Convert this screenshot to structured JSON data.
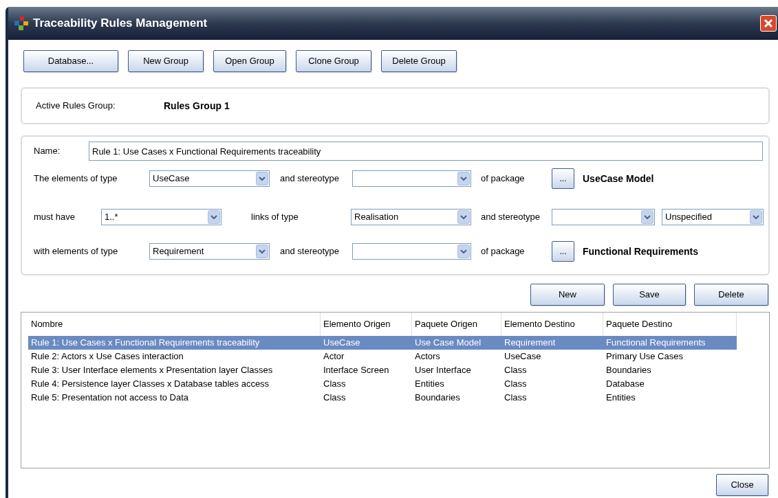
{
  "window": {
    "title": "Traceability Rules Management"
  },
  "toolbar_buttons": [
    "Database...",
    "New Group",
    "Open Group",
    "Clone Group",
    "Delete Group"
  ],
  "active_group": {
    "label": "Active Rules Group:",
    "value": "Rules Group 1"
  },
  "rule_form": {
    "name_label": "Name:",
    "name_value": "Rule 1: Use Cases x Functional Requirements traceability",
    "rows": [
      {
        "items": [
          {
            "kind": "label",
            "text": "The elements of type"
          },
          {
            "kind": "combo",
            "value": "UseCase"
          },
          {
            "kind": "label",
            "text": "and stereotype"
          },
          {
            "kind": "combo",
            "value": ""
          },
          {
            "kind": "label",
            "text": "of package"
          },
          {
            "kind": "browse",
            "text": "..."
          },
          {
            "kind": "package",
            "text": "UseCase Model"
          }
        ]
      },
      {
        "items": [
          {
            "kind": "label",
            "text": "must have"
          },
          {
            "kind": "combo",
            "value": "1..*"
          },
          {
            "kind": "label",
            "text": "links of type"
          },
          {
            "kind": "combo",
            "value": "Realisation"
          },
          {
            "kind": "label",
            "text": "and stereotype"
          },
          {
            "kind": "combo",
            "value": ""
          },
          {
            "kind": "combo",
            "value": "Unspecified"
          }
        ]
      },
      {
        "items": [
          {
            "kind": "label",
            "text": "with elements of type"
          },
          {
            "kind": "combo",
            "value": "Requirement"
          },
          {
            "kind": "label",
            "text": "and stereotype"
          },
          {
            "kind": "combo",
            "value": ""
          },
          {
            "kind": "label",
            "text": "of package"
          },
          {
            "kind": "browse",
            "text": "..."
          },
          {
            "kind": "package",
            "text": "Functional Requirements"
          }
        ]
      }
    ]
  },
  "rule_buttons": [
    "New",
    "Save",
    "Delete"
  ],
  "table": {
    "columns": [
      "Nombre",
      "Elemento Origen",
      "Paquete Origen",
      "Elemento Destino",
      "Paquete Destino"
    ],
    "rows": [
      {
        "selected": true,
        "cells": [
          "Rule 1: Use Cases x Functional Requirements traceability",
          "UseCase",
          "Use Case Model",
          "Requirement",
          "Functional Requirements"
        ]
      },
      {
        "selected": false,
        "cells": [
          "Rule 2: Actors x Use Cases interaction",
          "Actor",
          "Actors",
          "UseCase",
          "Primary Use Cases"
        ]
      },
      {
        "selected": false,
        "cells": [
          "Rule 3: User Interface elements x Presentation layer Classes",
          "Interface Screen",
          "User Interface",
          "Class",
          "Boundaries"
        ]
      },
      {
        "selected": false,
        "cells": [
          "Rule 4: Persistence layer Classes x Database tables access",
          "Class",
          "Entities",
          "Class",
          "Database"
        ]
      },
      {
        "selected": false,
        "cells": [
          "Rule 5: Presentation not access to Data",
          "Class",
          "Boundaries",
          "Class",
          "Entities"
        ]
      }
    ]
  },
  "close_button": "Close"
}
